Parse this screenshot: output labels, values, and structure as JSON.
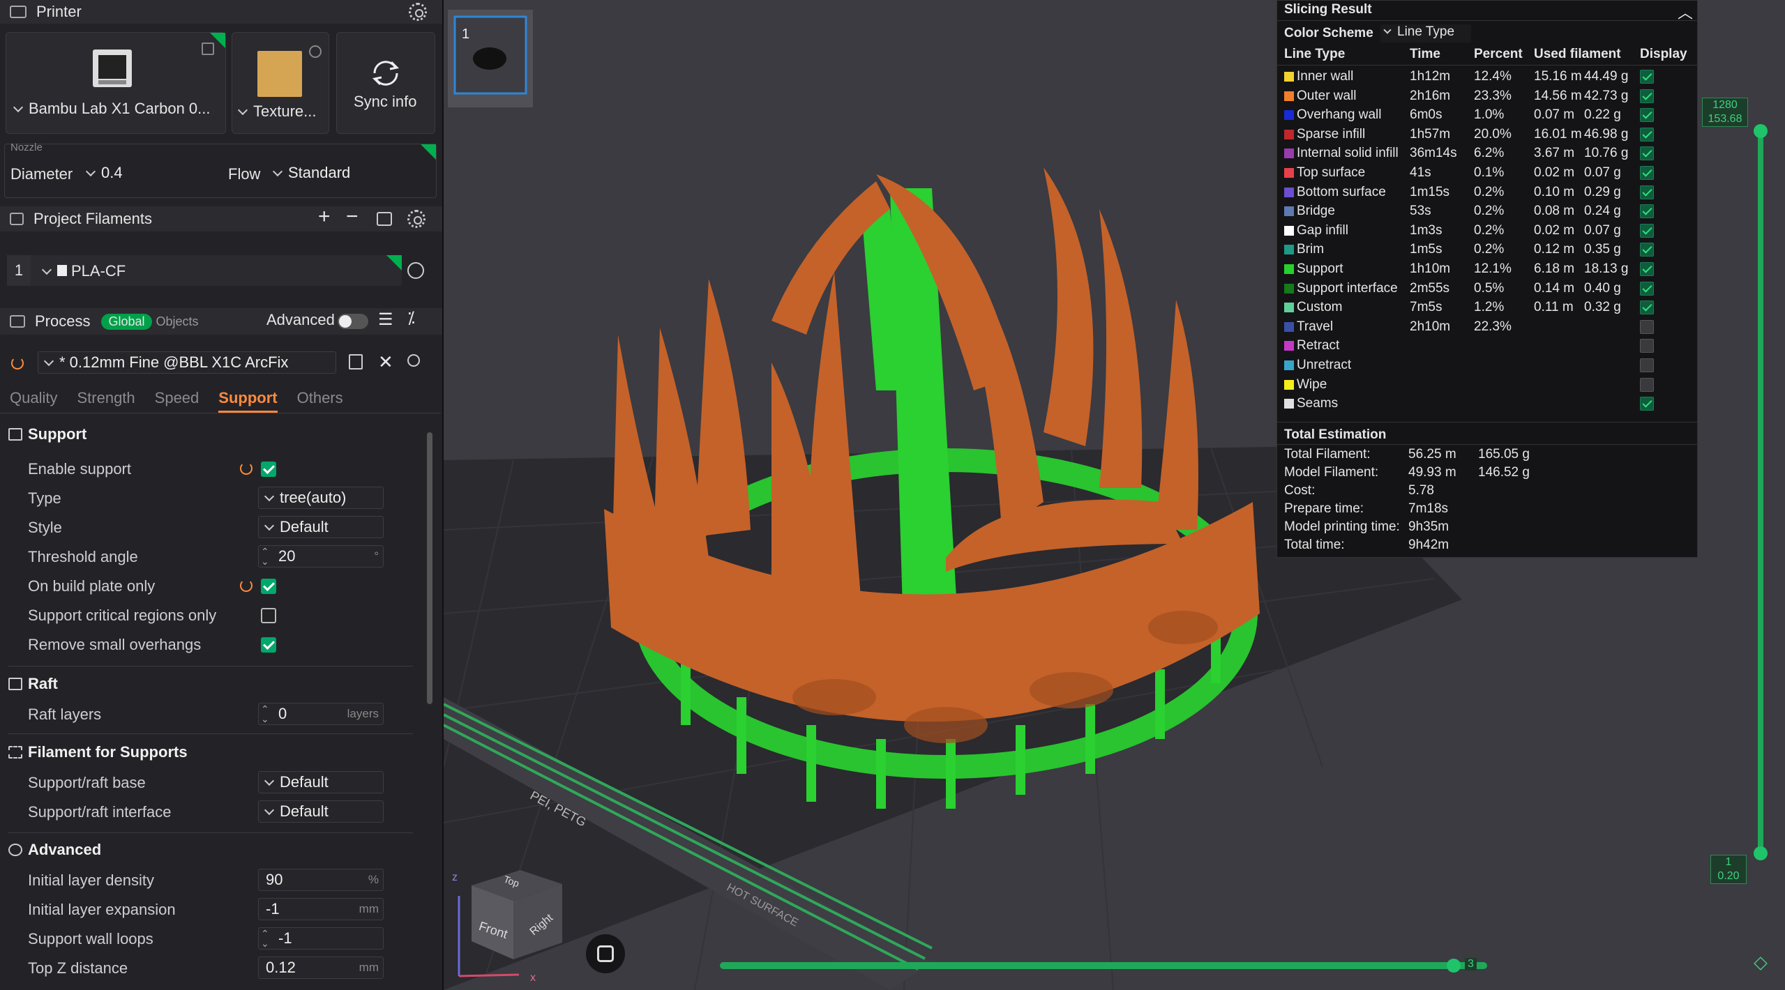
{
  "printer": {
    "header": "Printer",
    "machine_name": "Bambu Lab X1 Carbon 0...",
    "plate_name": "Texture...",
    "sync_label": "Sync info",
    "nozzle_label": "Nozzle",
    "diameter_label": "Diameter",
    "diameter_value": "0.4",
    "flow_label": "Flow",
    "flow_value": "Standard"
  },
  "filaments": {
    "header": "Project Filaments",
    "items": [
      {
        "index": "1",
        "name": "PLA-CF"
      }
    ]
  },
  "process": {
    "header": "Process",
    "global_label": "Global",
    "objects_label": "Objects",
    "advanced_label": "Advanced",
    "advanced_on": false,
    "preset": "* 0.12mm Fine @BBL X1C ArcFix",
    "tabs": [
      "Quality",
      "Strength",
      "Speed",
      "Support",
      "Others"
    ],
    "active_tab": "Support"
  },
  "support_section": {
    "title": "Support",
    "enable_support": {
      "label": "Enable support",
      "checked": true
    },
    "type": {
      "label": "Type",
      "value": "tree(auto)"
    },
    "style": {
      "label": "Style",
      "value": "Default"
    },
    "threshold_angle": {
      "label": "Threshold angle",
      "value": "20",
      "unit": "°"
    },
    "on_build_plate_only": {
      "label": "On build plate only",
      "checked": true
    },
    "critical_regions": {
      "label": "Support critical regions only",
      "checked": false
    },
    "remove_small": {
      "label": "Remove small overhangs",
      "checked": true
    }
  },
  "raft_section": {
    "title": "Raft",
    "raft_layers": {
      "label": "Raft layers",
      "value": "0",
      "unit": "layers"
    }
  },
  "filament_supports_section": {
    "title": "Filament for Supports",
    "base": {
      "label": "Support/raft base",
      "value": "Default"
    },
    "interface": {
      "label": "Support/raft interface",
      "value": "Default"
    }
  },
  "advanced_section": {
    "title": "Advanced",
    "initial_layer_density": {
      "label": "Initial layer density",
      "value": "90",
      "unit": "%"
    },
    "initial_layer_expansion": {
      "label": "Initial layer expansion",
      "value": "-1",
      "unit": "mm"
    },
    "support_wall_loops": {
      "label": "Support wall loops",
      "value": "-1"
    },
    "top_z_distance": {
      "label": "Top Z distance",
      "value": "0.12",
      "unit": "mm"
    }
  },
  "viewport": {
    "plate_number": "1",
    "bed_text": "PEI, PETG",
    "bed_text2": "HOT SURFACE",
    "top_layer": "1280",
    "top_height": "153.68",
    "bottom_layer": "1",
    "bottom_height": "0.20",
    "horizontal_end": "3",
    "cube_top": "Top",
    "cube_front": "Front",
    "cube_right": "Right",
    "axis_x": "x",
    "axis_z": "z"
  },
  "slicing_result": {
    "title": "Slicing Result",
    "color_scheme_label": "Color Scheme",
    "color_scheme_value": "Line Type",
    "columns": [
      "Line Type",
      "Time",
      "Percent",
      "Used filament",
      "Display"
    ],
    "rows": [
      {
        "name": "Inner wall",
        "color": "#f2d22e",
        "time": "1h12m",
        "percent": "12.4%",
        "len": "15.16 m",
        "weight": "44.49 g",
        "display": true
      },
      {
        "name": "Outer wall",
        "color": "#f07f2c",
        "time": "2h16m",
        "percent": "23.3%",
        "len": "14.56 m",
        "weight": "42.73 g",
        "display": true
      },
      {
        "name": "Overhang wall",
        "color": "#1a2ad6",
        "time": "6m0s",
        "percent": "1.0%",
        "len": "0.07 m",
        "weight": "0.22 g",
        "display": true
      },
      {
        "name": "Sparse infill",
        "color": "#c0282e",
        "time": "1h57m",
        "percent": "20.0%",
        "len": "16.01 m",
        "weight": "46.98 g",
        "display": true
      },
      {
        "name": "Internal solid infill",
        "color": "#9a3bb0",
        "time": "36m14s",
        "percent": "6.2%",
        "len": "3.67 m",
        "weight": "10.76 g",
        "display": true
      },
      {
        "name": "Top surface",
        "color": "#e8404a",
        "time": "41s",
        "percent": "0.1%",
        "len": "0.02 m",
        "weight": "0.07 g",
        "display": true
      },
      {
        "name": "Bottom surface",
        "color": "#6a4fd0",
        "time": "1m15s",
        "percent": "0.2%",
        "len": "0.10 m",
        "weight": "0.29 g",
        "display": true
      },
      {
        "name": "Bridge",
        "color": "#5d7ab3",
        "time": "53s",
        "percent": "0.2%",
        "len": "0.08 m",
        "weight": "0.24 g",
        "display": true
      },
      {
        "name": "Gap infill",
        "color": "#ffffff",
        "time": "1m3s",
        "percent": "0.2%",
        "len": "0.02 m",
        "weight": "0.07 g",
        "display": true
      },
      {
        "name": "Brim",
        "color": "#1f9a86",
        "time": "1m5s",
        "percent": "0.2%",
        "len": "0.12 m",
        "weight": "0.35 g",
        "display": true
      },
      {
        "name": "Support",
        "color": "#27d12c",
        "time": "1h10m",
        "percent": "12.1%",
        "len": "6.18 m",
        "weight": "18.13 g",
        "display": true
      },
      {
        "name": "Support interface",
        "color": "#147a1a",
        "time": "2m55s",
        "percent": "0.5%",
        "len": "0.14 m",
        "weight": "0.40 g",
        "display": true
      },
      {
        "name": "Custom",
        "color": "#5fcf9a",
        "time": "7m5s",
        "percent": "1.2%",
        "len": "0.11 m",
        "weight": "0.32 g",
        "display": true
      },
      {
        "name": "Travel",
        "color": "#3a4fa8",
        "time": "2h10m",
        "percent": "22.3%",
        "len": "",
        "weight": "",
        "display": false
      },
      {
        "name": "Retract",
        "color": "#c43ac4",
        "time": "",
        "percent": "",
        "len": "",
        "weight": "",
        "display": false
      },
      {
        "name": "Unretract",
        "color": "#38a5c8",
        "time": "",
        "percent": "",
        "len": "",
        "weight": "",
        "display": false
      },
      {
        "name": "Wipe",
        "color": "#f5ee1a",
        "time": "",
        "percent": "",
        "len": "",
        "weight": "",
        "display": false
      },
      {
        "name": "Seams",
        "color": "#e0e0e0",
        "time": "",
        "percent": "",
        "len": "",
        "weight": "",
        "display": true
      }
    ],
    "total_title": "Total Estimation",
    "totals": [
      {
        "label": "Total Filament:",
        "v1": "56.25 m",
        "v2": "165.05 g"
      },
      {
        "label": "Model Filament:",
        "v1": "49.93 m",
        "v2": "146.52 g"
      },
      {
        "label": "Cost:",
        "v1": "5.78",
        "v2": ""
      },
      {
        "label": "Prepare time:",
        "v1": "7m18s",
        "v2": ""
      },
      {
        "label": "Model printing time:",
        "v1": "9h35m",
        "v2": ""
      },
      {
        "label": "Total time:",
        "v1": "9h42m",
        "v2": ""
      }
    ]
  }
}
